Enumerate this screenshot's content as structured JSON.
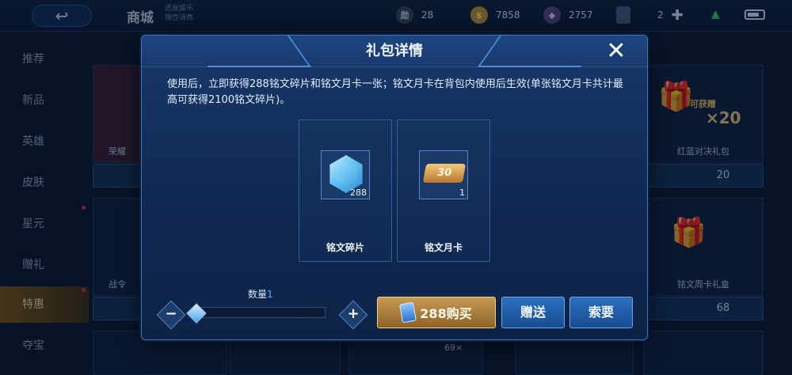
{
  "topbar": {
    "back_icon": "back-arrow-icon",
    "title": "商城",
    "subtitle_line1": "适度娱乐",
    "subtitle_line2": "理性消费",
    "currencies": [
      {
        "icon": "token-icon",
        "icon_text": "勋",
        "value": "28"
      },
      {
        "icon": "coin-icon",
        "icon_text": "$",
        "value": "7858"
      },
      {
        "icon": "diamond-icon",
        "icon_text": "◆",
        "value": "2757"
      },
      {
        "icon": "voucher-icon",
        "icon_text": "",
        "value": "2"
      }
    ],
    "add_icon": "plus-icon"
  },
  "sidebar": {
    "items": [
      {
        "label": "推荐"
      },
      {
        "label": "新品"
      },
      {
        "label": "英雄"
      },
      {
        "label": "皮肤"
      },
      {
        "label": "星元"
      },
      {
        "label": "赠礼"
      },
      {
        "label": "特惠"
      },
      {
        "label": "夺宝"
      }
    ]
  },
  "background": {
    "card1_label": "荣耀",
    "card2_label": "战令",
    "right_card1": {
      "badge": "可获赠",
      "multiplier": "×20",
      "label": "红蓝对决礼包",
      "price": "20"
    },
    "right_card2": {
      "label": "铭文周卡礼盒",
      "price": "68"
    },
    "bottom_badge": "69×"
  },
  "modal": {
    "title": "礼包详情",
    "description": "使用后，立即获得288铭文碎片和铭文月卡一张；铭文月卡在背包内使用后生效(单张铭文月卡共计最高可获得2100铭文碎片)。",
    "items": [
      {
        "name": "铭文碎片",
        "qty": "288",
        "icon": "inscription-shard-icon"
      },
      {
        "name": "铭文月卡",
        "qty": "1",
        "icon": "inscription-month-card-icon",
        "icon_text": "30"
      }
    ],
    "quantity_label": "数量",
    "quantity_value": "1",
    "quantity_fraction": 0.0,
    "buy_label": "288购买",
    "gift_label": "赠送",
    "request_label": "索要",
    "colors": {
      "buy": "#c79a55",
      "action": "#2a6fbf"
    }
  }
}
